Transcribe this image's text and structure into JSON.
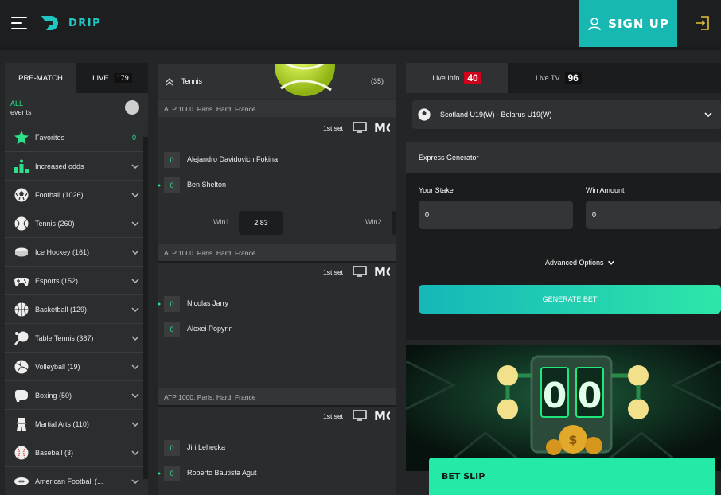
{
  "header": {
    "logo_text": "DRIP",
    "signup_label": "SIGN UP",
    "brand_color": "#17b7b2"
  },
  "sidebar": {
    "tabs": [
      {
        "label": "PRE-MATCH"
      },
      {
        "label": "LIVE",
        "count": "179"
      }
    ],
    "all_events": {
      "line1": "ALL",
      "line2": "events"
    },
    "items": [
      {
        "label": "Favorites",
        "count": "0",
        "icon": "star-icon"
      },
      {
        "label": "Increased odds",
        "icon": "podium-icon"
      },
      {
        "label": "Football (1026)",
        "icon": "football-icon"
      },
      {
        "label": "Tennis (260)",
        "icon": "tennis-icon"
      },
      {
        "label": "Ice Hockey (161)",
        "icon": "puck-icon"
      },
      {
        "label": "Esports (152)",
        "icon": "gamepad-icon"
      },
      {
        "label": "Basketball (129)",
        "icon": "basketball-icon"
      },
      {
        "label": "Table Tennis (387)",
        "icon": "pingpong-icon"
      },
      {
        "label": "Volleyball (19)",
        "icon": "volleyball-icon"
      },
      {
        "label": "Boxing (50)",
        "icon": "boxing-icon"
      },
      {
        "label": "Martial Arts (110)",
        "icon": "martial-arts-icon"
      },
      {
        "label": "Baseball (3)",
        "icon": "baseball-icon"
      },
      {
        "label": "American Football (...",
        "icon": "american-football-icon"
      }
    ]
  },
  "events": {
    "sport_title": "Tennis",
    "sport_count": "(35)",
    "matches": [
      {
        "league": "ATP 1000. Paris. Hard. France",
        "set": "1st set",
        "p1": {
          "name": "Alejandro Davidovich Fokina",
          "score": "0"
        },
        "p2": {
          "name": "Ben Shelton",
          "score": "0"
        },
        "win1_label": "Win1",
        "win1_odd": "2.83",
        "win2_label": "Win2"
      },
      {
        "league": "ATP 1000. Paris. Hard. France",
        "set": "1st set",
        "p1": {
          "name": "Nicolas Jarry",
          "score": "0"
        },
        "p2": {
          "name": "Alexei Popyrin",
          "score": "0"
        }
      },
      {
        "league": "ATP 1000. Paris. Hard. France",
        "set": "1st set",
        "p1": {
          "name": "Jiri Lehecka",
          "score": "0"
        },
        "p2": {
          "name": "Roberto Bautista Agut",
          "score": "0"
        }
      }
    ]
  },
  "right": {
    "live_info_label": "Live Info",
    "live_info_count": "40",
    "live_tv_label": "Live TV",
    "live_tv_count": "96",
    "selected_match": "Scotland U19(W) - Belarus U19(W)",
    "express": {
      "title": "Express Generator",
      "stake_label": "Your Stake",
      "stake_value": "0",
      "win_label": "Win Amount",
      "win_value": "0",
      "advanced_label": "Advanced Options",
      "generate_label": "GENERATE BET"
    },
    "promo_digits": [
      "0",
      "0"
    ],
    "betslip_label": "BET SLIP"
  }
}
